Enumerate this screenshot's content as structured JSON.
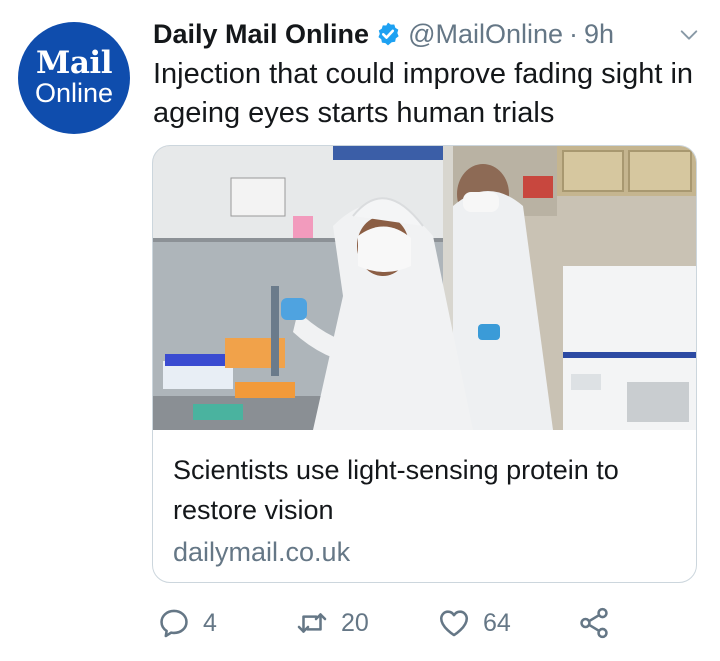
{
  "account": {
    "avatar": {
      "line1": "Mail",
      "line2": "Online"
    },
    "name": "Daily Mail Online",
    "handle": "@MailOnline",
    "separator": "·",
    "time": "9h"
  },
  "tweet": {
    "text": "Injection that could improve fading sight in ageing eyes starts human trials"
  },
  "card": {
    "title": "Scientists use light-sensing protein to restore vision",
    "domain": "dailymail.co.uk"
  },
  "actions": {
    "reply_count": "4",
    "retweet_count": "20",
    "like_count": "64"
  },
  "colors": {
    "brand": "#0f4dad",
    "verified": "#1da1f2",
    "muted": "#657786",
    "text": "#14171a",
    "border": "#ccd6dd"
  },
  "icons": [
    "verified-badge-icon",
    "chevron-down-icon",
    "reply-icon",
    "retweet-icon",
    "like-icon",
    "share-icon"
  ]
}
